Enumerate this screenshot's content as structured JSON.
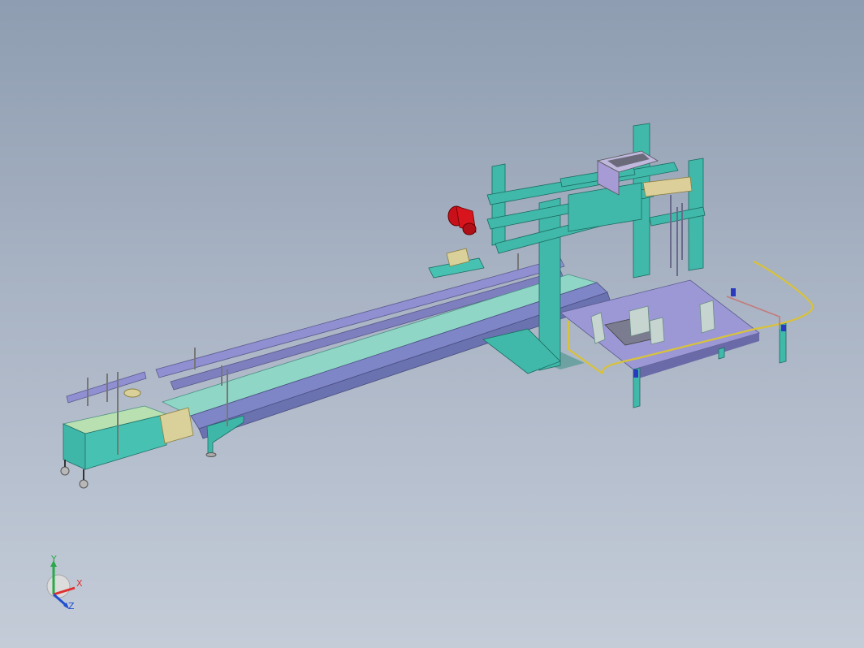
{
  "view": {
    "background_top": "#8e9db1",
    "background_bottom": "#c4ccd8",
    "frame_color": "#3fb7a8",
    "conveyor_color": "#7a86c4",
    "belt_color": "#7fd0c0",
    "motor_color": "#d0121a",
    "rail_color": "#d8c23a",
    "guard_color": "#b7a6e0",
    "tan_color": "#d9d09a"
  },
  "triad": {
    "x_label": "X",
    "y_label": "Y",
    "z_label": "Z",
    "x_color": "#e03030",
    "y_color": "#2aa84a",
    "z_color": "#2050d0"
  }
}
